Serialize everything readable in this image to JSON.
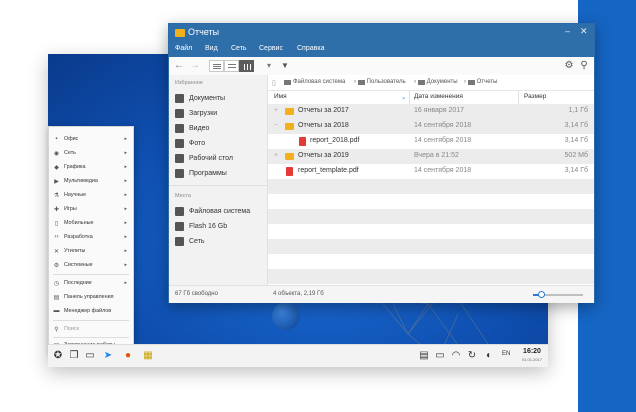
{
  "desktop": {
    "start_menu": {
      "items": [
        {
          "label": "Офис",
          "icon": "briefcase-icon",
          "arrow": "▸"
        },
        {
          "label": "Сеть",
          "icon": "globe-icon",
          "arrow": "▸"
        },
        {
          "label": "Графика",
          "icon": "palette-icon",
          "arrow": "▸"
        },
        {
          "label": "Мультимедиа",
          "icon": "play-icon",
          "arrow": "▸"
        },
        {
          "label": "Научные",
          "icon": "flask-icon",
          "arrow": "▸"
        },
        {
          "label": "Игры",
          "icon": "gamepad-icon",
          "arrow": "▸"
        },
        {
          "label": "Мобильные",
          "icon": "phone-icon",
          "arrow": "▸"
        },
        {
          "label": "Разработка",
          "icon": "code-icon",
          "arrow": "▸"
        },
        {
          "label": "Утилиты",
          "icon": "tools-icon",
          "arrow": "▸"
        },
        {
          "label": "Системные",
          "icon": "gear-icon",
          "arrow": "▸"
        },
        {
          "label": "Последние",
          "icon": "clock-icon",
          "arrow": "▸"
        },
        {
          "label": "Панель управления",
          "icon": "settings-icon",
          "arrow": ""
        },
        {
          "label": "Менеджер файлов",
          "icon": "folder-icon",
          "arrow": ""
        }
      ],
      "search_placeholder": "Поиск",
      "shutdown_label": "Завершение работы..."
    },
    "taskbar": {
      "lang": "EN",
      "time": "16:20",
      "date": "01.01.2017"
    }
  },
  "window": {
    "title": "Отчеты",
    "menu": [
      "Файл",
      "Вид",
      "Сеть",
      "Сервис",
      "Справка"
    ],
    "sidebar": {
      "favorites_header": "Избранное",
      "favorites": [
        "Документы",
        "Загрузки",
        "Видео",
        "Фото",
        "Рабочий стол",
        "Программы"
      ],
      "places_header": "Места",
      "places": [
        "Файловая система",
        "Flash 16 Gb",
        "Сеть"
      ]
    },
    "breadcrumbs": [
      "Файловая система",
      "Пользователь",
      "Документы",
      "Отчеты"
    ],
    "columns": {
      "name": "Имя",
      "date": "Дата изменения",
      "size": "Размер"
    },
    "rows": [
      {
        "type": "folder",
        "expander": "+",
        "name": "Отчеты за 2017",
        "date": "16 января 2017",
        "size": "1,1 Гб"
      },
      {
        "type": "folder",
        "expander": "−",
        "name": "Отчеты за 2018",
        "date": "14 сентября 2018",
        "size": "3,14 Гб"
      },
      {
        "type": "pdf",
        "expander": "",
        "name": "report_2018.pdf",
        "date": "14 сентября 2018",
        "size": "3,14 Гб"
      },
      {
        "type": "folder",
        "expander": "+",
        "name": "Отчеты за 2019",
        "date": "Вчера в 21:52",
        "size": "502 Мб"
      },
      {
        "type": "pdf",
        "expander": "",
        "name": "report_template.pdf",
        "date": "14 сентября 2018",
        "size": "3,14 Гб"
      }
    ],
    "status": {
      "free": "67 Гб свободно",
      "selection": "4 объекта, 2,19 Гб",
      "zoom_level": 0.15
    }
  }
}
